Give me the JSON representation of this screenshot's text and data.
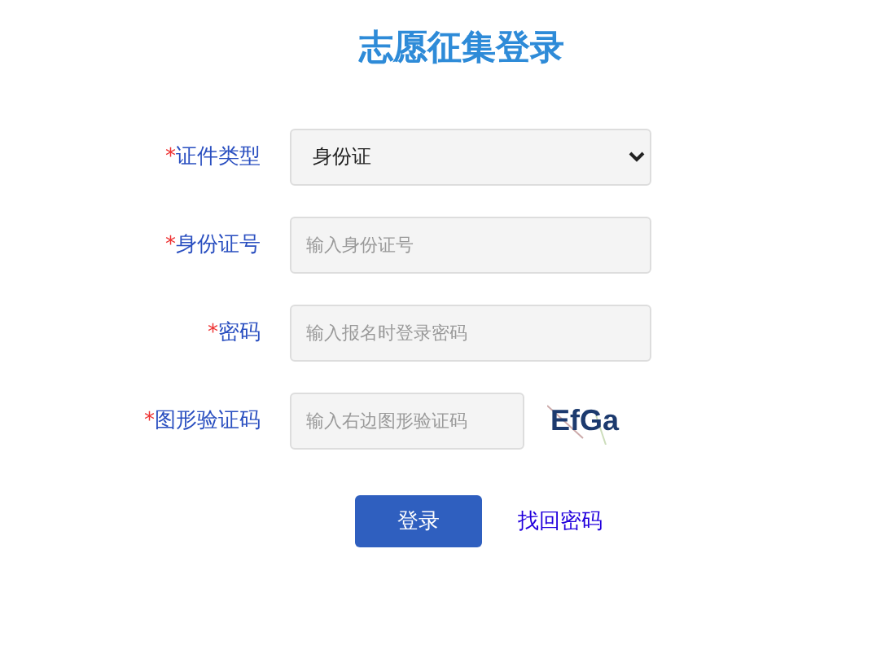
{
  "title": "志愿征集登录",
  "fields": [
    {
      "kind": "select",
      "required_mark": "*",
      "label": "证件类型",
      "value": "身份证"
    },
    {
      "kind": "input",
      "required_mark": "*",
      "label": "身份证号",
      "placeholder": "输入身份证号"
    },
    {
      "kind": "input",
      "required_mark": "*",
      "label": "密码",
      "placeholder": "输入报名时登录密码"
    },
    {
      "kind": "captcha",
      "required_mark": "*",
      "label": "图形验证码",
      "placeholder": "输入右边图形验证码",
      "captcha": "EfGa"
    }
  ],
  "submit": "登录",
  "link": "找回密码"
}
